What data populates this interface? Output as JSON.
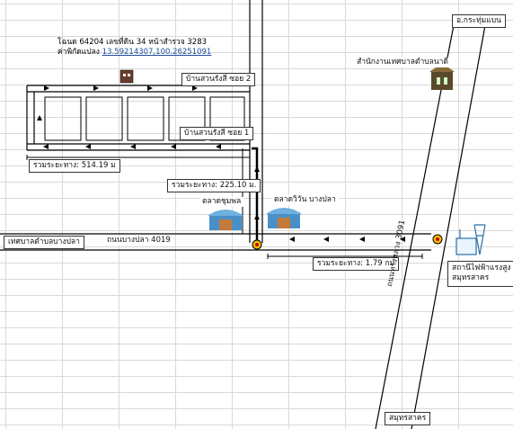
{
  "labels": {
    "deed_line1": "โฉนด 64204 เลขที่ดิน 34 หน้าสำรวจ 3283",
    "deed_coord_prefix": "ค่าพิกัดแปลง ",
    "deed_coord": "13.59214307,100.26251091",
    "soi2": "บ้านสวนรังสี  ซอย 2",
    "soi1": "บ้านสวนรังสี  ซอย 1",
    "dist_total1": "รวมระยะทาง: 514.19 ม",
    "dist_total2": "รวมระยะทาง: 225.10 ม.",
    "dist_total3": "รวมระยะทาง: 1.79 กม",
    "market_chumphon": "ตลาดชุมพล",
    "market_wiwan": "ตลาดวิวัน บางปลา",
    "municipality": "เทศบาลตำบลบางปลา",
    "road_4019": "ถนนบางปลา 4019",
    "krathum_baen": "อ.กระทุ่มแบน",
    "office_nadi": "สำนักงานเทศบาลตำบลนาดี",
    "substation_line1": "สถานีไฟฟ้าแรงสูง",
    "substation_line2": "สมุทรสาคร",
    "samut_sakhon": "สมุทรสาคร",
    "road_3091": "ถนนทางหลวง 3091"
  },
  "icons": {
    "plot_building": "building-icon",
    "office_building": "government-office-icon",
    "market1": "market-icon",
    "market2": "market-icon",
    "substation": "power-station-icon",
    "traffic_light": "traffic-light-icon",
    "direction_arrow": "arrow-icon"
  },
  "colors": {
    "road_line": "#000000",
    "grid": "#d9d9d9",
    "link": "#1f4e9e",
    "market_blue": "#4a90c8",
    "traffic_yellow": "#f2c200"
  }
}
